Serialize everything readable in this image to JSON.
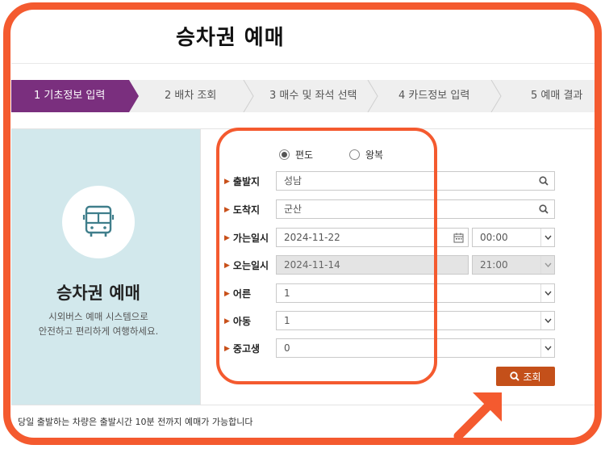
{
  "page": {
    "title": "승차권 예매"
  },
  "steps": [
    {
      "label": "1 기초정보 입력",
      "active": true
    },
    {
      "label": "2 배차 조회",
      "active": false
    },
    {
      "label": "3 매수 및 좌석 선택",
      "active": false
    },
    {
      "label": "4 카드정보 입력",
      "active": false
    },
    {
      "label": "5 예매 결과",
      "active": false
    }
  ],
  "left_panel": {
    "icon": "bus-icon",
    "title": "승차권 예매",
    "desc_line1": "시외버스 예매 시스템으로",
    "desc_line2": "안전하고 편리하게 여행하세요."
  },
  "trip_type": {
    "one_way": "편도",
    "round_trip": "왕복",
    "selected": "편도"
  },
  "form": {
    "departure": {
      "label": "출발지",
      "value": "성남"
    },
    "arrival": {
      "label": "도착지",
      "value": "군산"
    },
    "go_datetime": {
      "label": "가는일시",
      "date": "2024-11-22",
      "time": "00:00"
    },
    "return_datetime": {
      "label": "오는일시",
      "date": "2024-11-14",
      "time": "21:00"
    },
    "adult": {
      "label": "어른",
      "value": "1"
    },
    "child": {
      "label": "아동",
      "value": "1"
    },
    "teen": {
      "label": "중고생",
      "value": "0"
    }
  },
  "search_button": {
    "label": "조회"
  },
  "notice": "당일 출발하는 차량은 출발시간 10분 전까지 예매가 가능합니다",
  "colors": {
    "step_active": "#7a2f7e",
    "accent": "#c4501a",
    "panel_bg": "#d2e8ec",
    "annotation": "#f45a2f"
  }
}
